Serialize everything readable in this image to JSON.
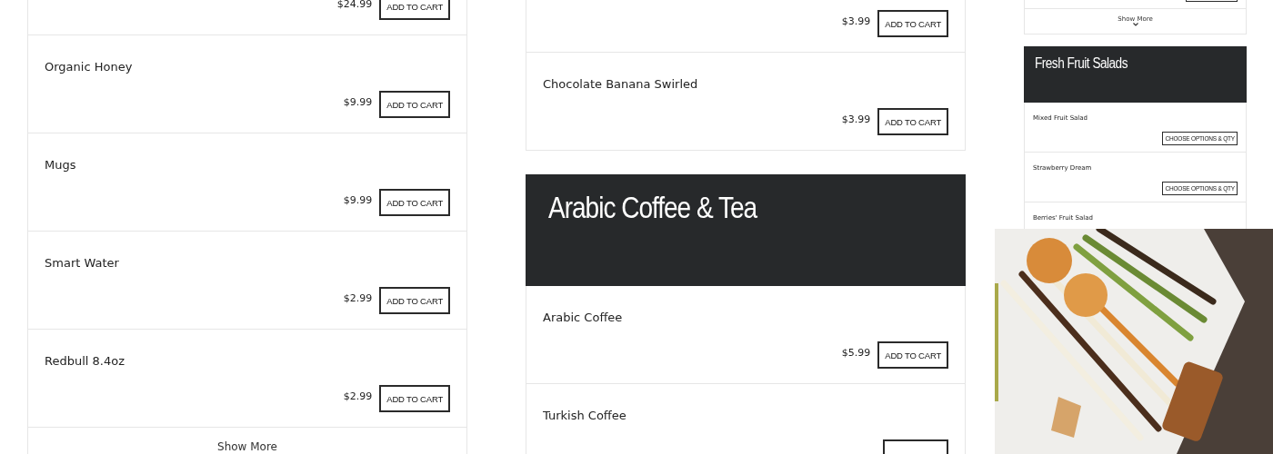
{
  "columns": [
    {
      "compact": false,
      "blocks": [
        {
          "kind": "item",
          "price": "$24.99",
          "button": "ADD TO CART"
        },
        {
          "kind": "item",
          "name": "Organic Honey",
          "price": "$9.99",
          "button": "ADD TO CART"
        },
        {
          "kind": "item",
          "name": "Mugs",
          "price": "$9.99",
          "button": "ADD TO CART"
        },
        {
          "kind": "item",
          "name": "Smart Water",
          "price": "$2.99",
          "button": "ADD TO CART"
        },
        {
          "kind": "item",
          "name": "Redbull 8.4oz",
          "price": "$2.99",
          "button": "ADD TO CART"
        },
        {
          "kind": "show_more",
          "label": "Show More"
        }
      ]
    },
    {
      "compact": false,
      "blocks": [
        {
          "kind": "item",
          "price": "$3.99",
          "button": "ADD TO CART"
        },
        {
          "kind": "item",
          "name": "Chocolate Banana Swirled",
          "price": "$3.99",
          "button": "ADD TO CART"
        },
        {
          "kind": "header",
          "title": "Arabic Coffee & Tea"
        },
        {
          "kind": "item",
          "name": "Arabic Coffee",
          "price": "$5.99",
          "button": "ADD TO CART"
        },
        {
          "kind": "item",
          "name": "Turkish Coffee",
          "cut_button": true
        }
      ]
    },
    {
      "compact": true,
      "blocks": [
        {
          "kind": "item",
          "cut_button": true
        },
        {
          "kind": "show_more",
          "label": "Show More"
        },
        {
          "kind": "header",
          "title": "Fresh Fruit Salads"
        },
        {
          "kind": "item",
          "name": "Mixed Fruit Salad",
          "button": "CHOOSE OPTIONS & QTY"
        },
        {
          "kind": "item",
          "name": "Strawberry Dream",
          "button": "CHOOSE OPTIONS & QTY"
        },
        {
          "kind": "item",
          "name": "Berries' Fruit Salad"
        }
      ]
    }
  ]
}
